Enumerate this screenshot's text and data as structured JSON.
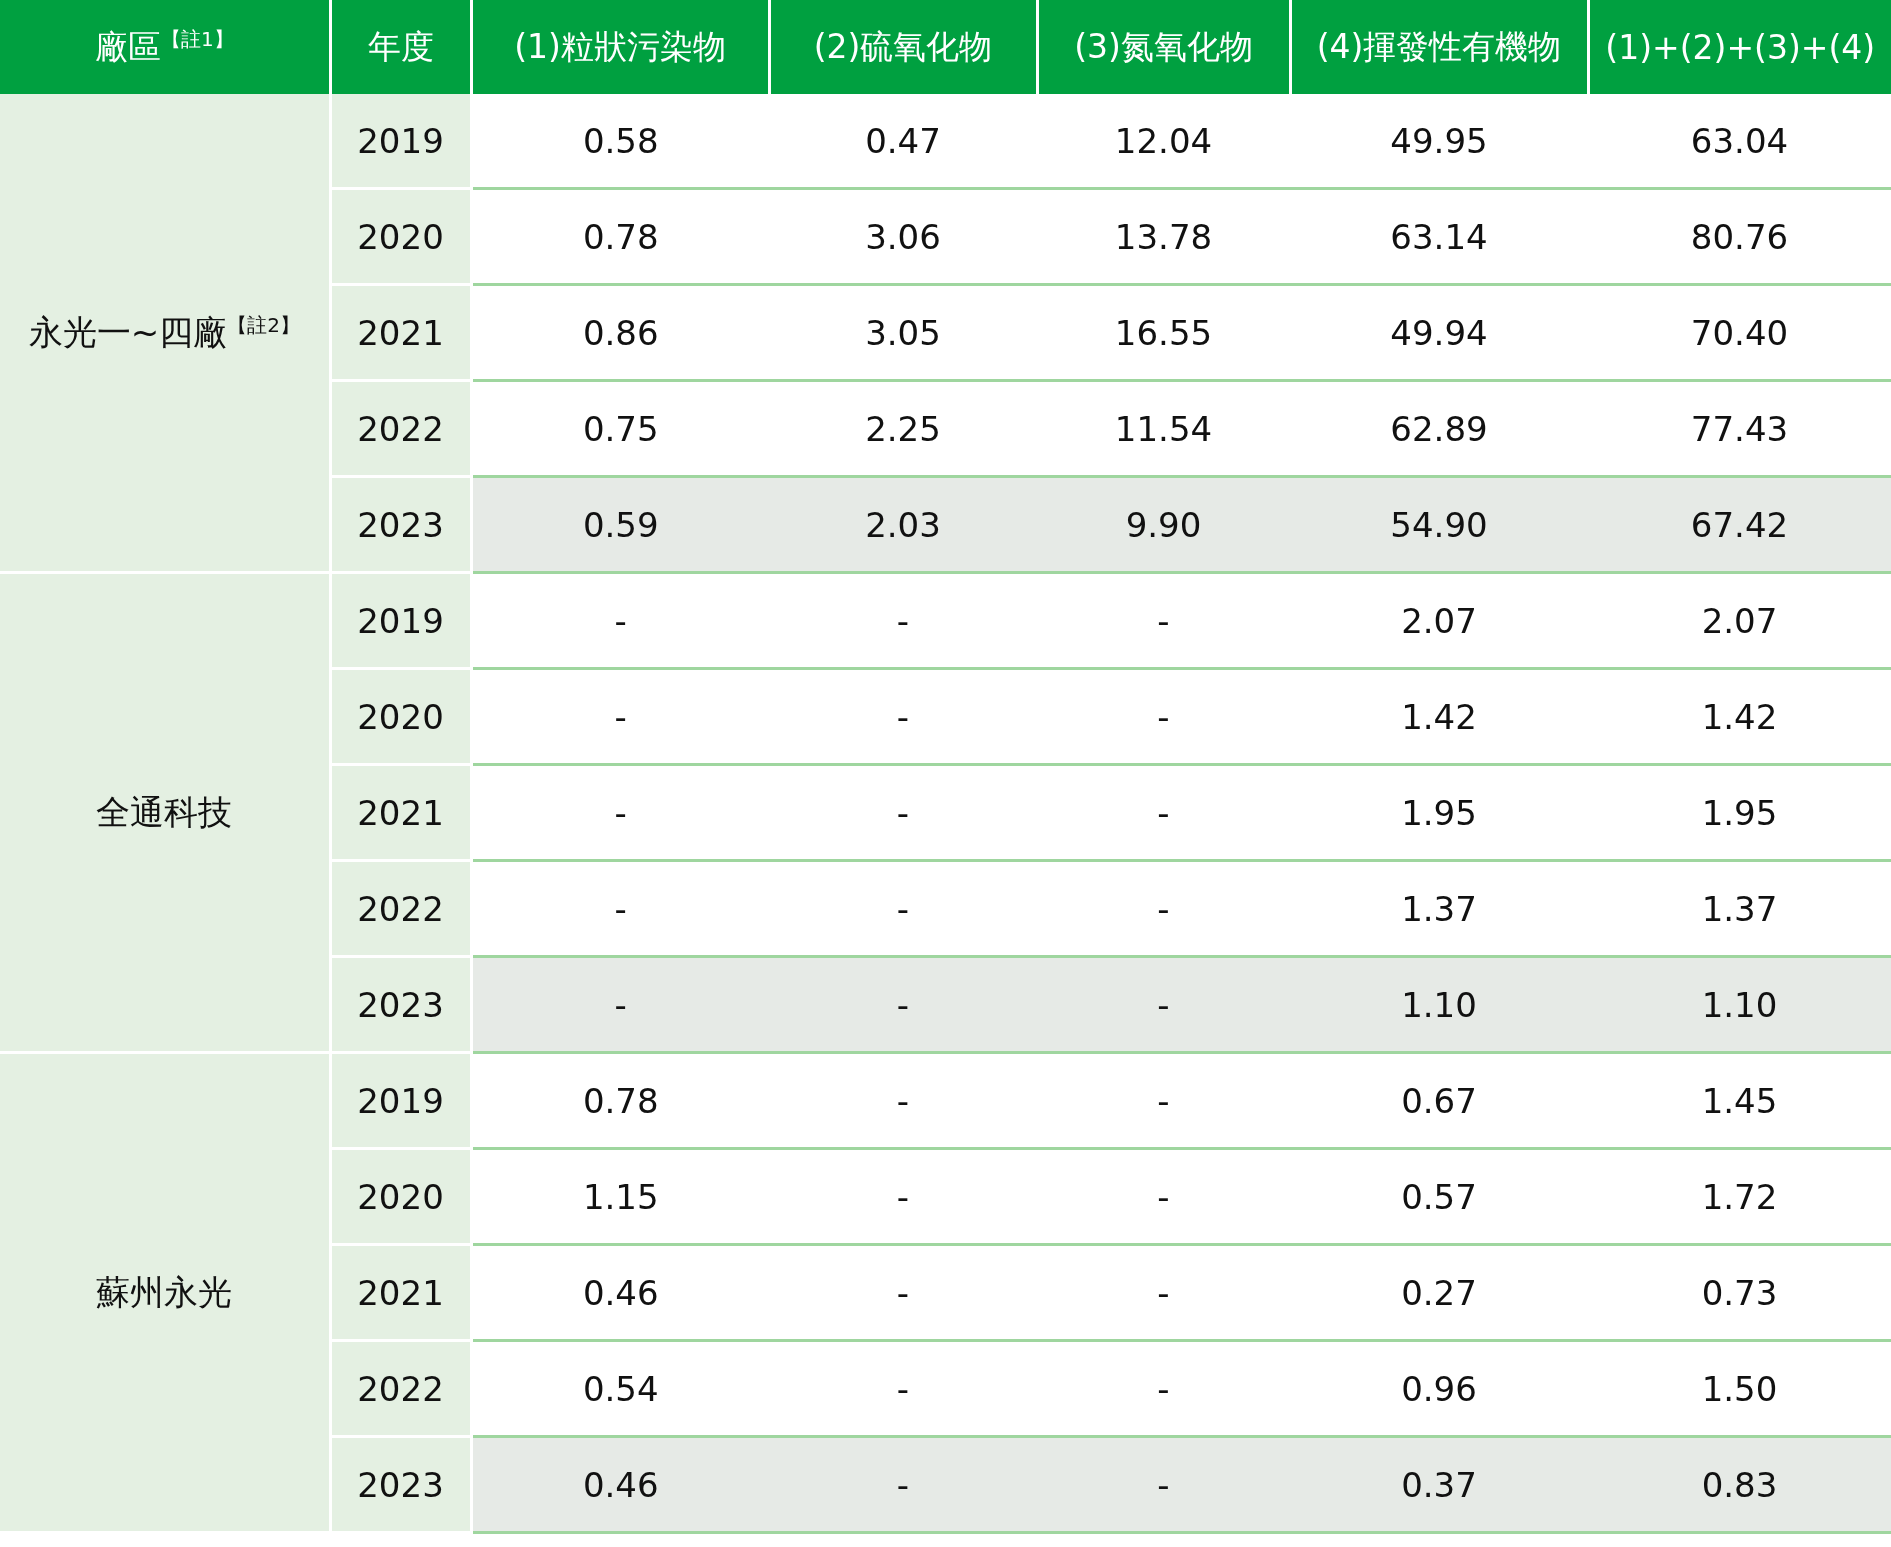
{
  "table": {
    "columns": [
      "廠區$^{【註1】}$",
      "年度",
      "(1)粒狀污染物",
      "(2)硫氧化物",
      "(3)氮氧化物",
      "(4)揮發性有機物",
      "(1)+(2)+(3)+(4)"
    ],
    "groups": [
      {
        "site": "永光一~四廠$^{【註2】}$",
        "rows": [
          {
            "year": "2019",
            "values": [
              "0.58",
              "0.47",
              "12.04",
              "49.95",
              "63.04"
            ],
            "highlighted": false
          },
          {
            "year": "2020",
            "values": [
              "0.78",
              "3.06",
              "13.78",
              "63.14",
              "80.76"
            ],
            "highlighted": false
          },
          {
            "year": "2021",
            "values": [
              "0.86",
              "3.05",
              "16.55",
              "49.94",
              "70.40"
            ],
            "highlighted": false
          },
          {
            "year": "2022",
            "values": [
              "0.75",
              "2.25",
              "11.54",
              "62.89",
              "77.43"
            ],
            "highlighted": false
          },
          {
            "year": "2023",
            "values": [
              "0.59",
              "2.03",
              "9.90",
              "54.90",
              "67.42"
            ],
            "highlighted": true
          }
        ]
      },
      {
        "site": "全通科技",
        "rows": [
          {
            "year": "2019",
            "values": [
              "-",
              "-",
              "-",
              "2.07",
              "2.07"
            ],
            "highlighted": false
          },
          {
            "year": "2020",
            "values": [
              "-",
              "-",
              "-",
              "1.42",
              "1.42"
            ],
            "highlighted": false
          },
          {
            "year": "2021",
            "values": [
              "-",
              "-",
              "-",
              "1.95",
              "1.95"
            ],
            "highlighted": false
          },
          {
            "year": "2022",
            "values": [
              "-",
              "-",
              "-",
              "1.37",
              "1.37"
            ],
            "highlighted": false
          },
          {
            "year": "2023",
            "values": [
              "-",
              "-",
              "-",
              "1.10",
              "1.10"
            ],
            "highlighted": true
          }
        ]
      },
      {
        "site": "蘇州永光",
        "rows": [
          {
            "year": "2019",
            "values": [
              "0.78",
              "-",
              "-",
              "0.67",
              "1.45"
            ],
            "highlighted": false
          },
          {
            "year": "2020",
            "values": [
              "1.15",
              "-",
              "-",
              "0.57",
              "1.72"
            ],
            "highlighted": false
          },
          {
            "year": "2021",
            "values": [
              "0.46",
              "-",
              "-",
              "0.27",
              "0.73"
            ],
            "highlighted": false
          },
          {
            "year": "2022",
            "values": [
              "0.54",
              "-",
              "-",
              "0.96",
              "1.50"
            ],
            "highlighted": false
          },
          {
            "year": "2023",
            "values": [
              "0.46",
              "-",
              "-",
              "0.37",
              "0.83"
            ],
            "highlighted": true
          }
        ]
      }
    ]
  }
}
